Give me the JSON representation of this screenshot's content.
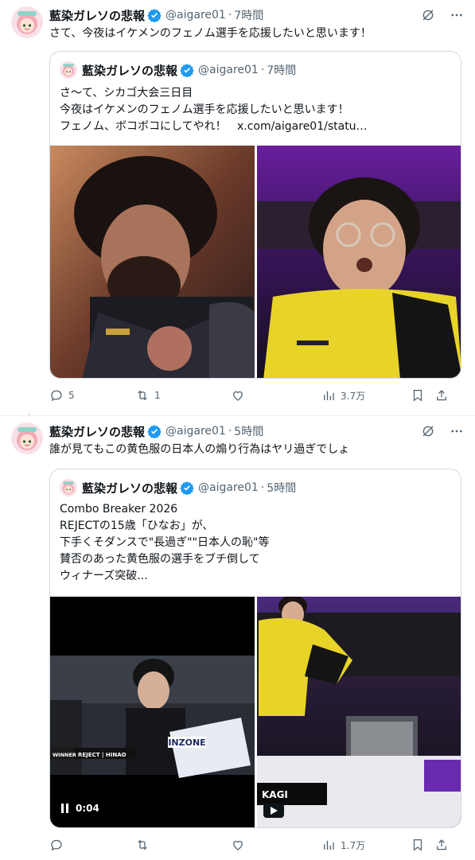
{
  "tweets": [
    {
      "author_name": "藍染ガレソの悲報",
      "handle": "@aigare01",
      "time": "7時間",
      "text": "さて、今夜はイケメンのフェノム選手を応援したいと思います！",
      "quote": {
        "author_name": "藍染ガレソの悲報",
        "handle": "@aigare01",
        "time": "7時間",
        "lines": [
          "さ～て、シカゴ大会三日目",
          "今夜はイケメンのフェノム選手を応援したいと思います！",
          "フェノム、ボコボコにしてやれ！"
        ],
        "link": "x.com/aigare01/statu…"
      },
      "stats": {
        "replies": "5",
        "reposts": "1",
        "likes": "",
        "views": "3.7万"
      }
    },
    {
      "author_name": "藍染ガレソの悲報",
      "handle": "@aigare01",
      "time": "5時間",
      "text": "誰が見てもこの黄色服の日本人の煽り行為はヤリ過ぎでしょ",
      "quote": {
        "author_name": "藍染ガレソの悲報",
        "handle": "@aigare01",
        "time": "5時間",
        "lines": [
          "Combo Breaker 2026",
          "REJECTの15歳「ひなお」が、",
          "下手くそダンスで\"長過ぎ\"\"日本人の恥\"等",
          "賛否のあった黄色服の選手をブチ倒して",
          "ウィナーズ突破..."
        ],
        "video": {
          "overlay_winner": "WINNER",
          "overlay_team": "REJECT | HINAO",
          "banner": "INZONE",
          "nameplate": "KAGI",
          "elapsed": "0:04"
        }
      },
      "stats": {
        "replies": "",
        "reposts": "",
        "likes": "",
        "views": "1.7万"
      }
    }
  ],
  "colors": {
    "text": "#0f1419",
    "muted": "#536471",
    "verified": "#1d9bf0",
    "border": "#cfd9de"
  }
}
